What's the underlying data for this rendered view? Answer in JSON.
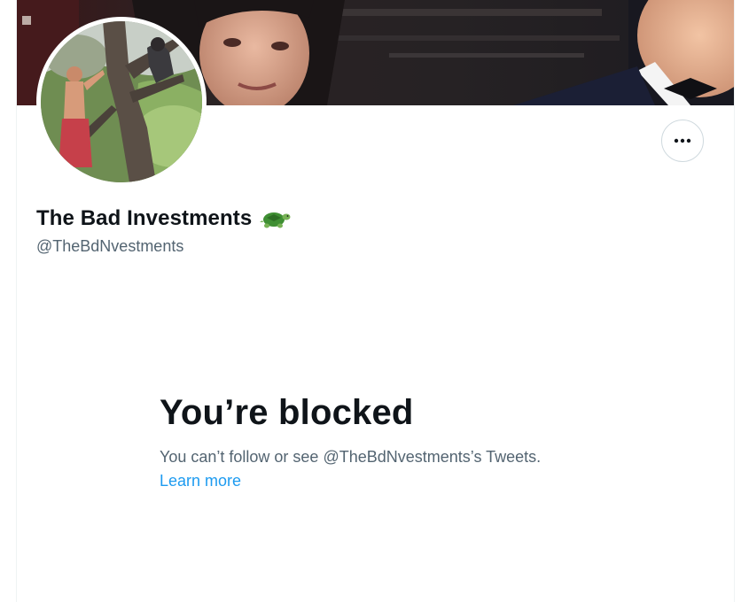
{
  "profile": {
    "display_name": "The Bad Investments",
    "name_emoji_icon": "turtle-icon",
    "handle": "@TheBdNvestments"
  },
  "blocked": {
    "title": "You’re blocked",
    "description": "You can’t follow or see @TheBdNvestments’s Tweets.",
    "learn_more": "Learn more"
  },
  "colors": {
    "text_primary": "#0f1419",
    "text_secondary": "#536471",
    "link": "#1d9bf0",
    "border": "#cfd9de"
  },
  "icons": {
    "more": "more-dots-icon"
  }
}
